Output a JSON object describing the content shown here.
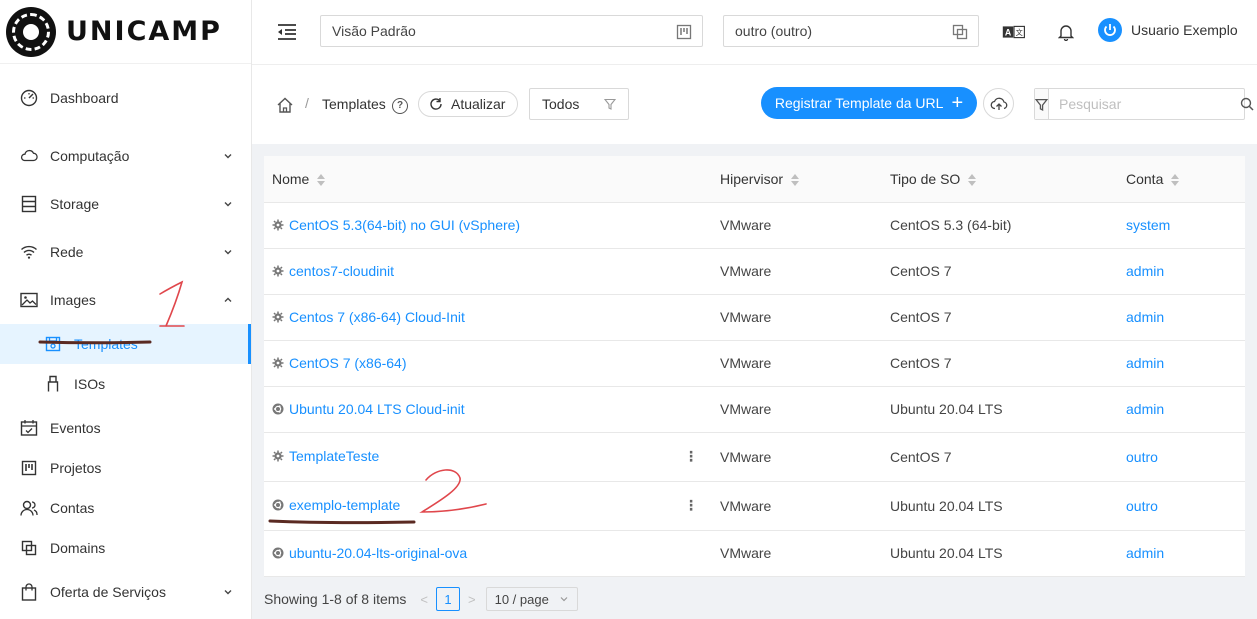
{
  "logo": {
    "text": "UNICAMP"
  },
  "sidebar": {
    "items": [
      {
        "label": "Dashboard",
        "icon": "dashboard-icon"
      },
      {
        "label": "Computação",
        "icon": "cloud-icon",
        "expandable": true
      },
      {
        "label": "Storage",
        "icon": "storage-icon",
        "expandable": true
      },
      {
        "label": "Rede",
        "icon": "wifi-icon",
        "expandable": true
      },
      {
        "label": "Images",
        "icon": "picture-icon",
        "expanded": true
      },
      {
        "label": "Templates",
        "icon": "save-icon",
        "active": true
      },
      {
        "label": "ISOs",
        "icon": "usb-icon"
      },
      {
        "label": "Eventos",
        "icon": "schedule-icon"
      },
      {
        "label": "Projetos",
        "icon": "project-icon"
      },
      {
        "label": "Contas",
        "icon": "team-icon"
      },
      {
        "label": "Domains",
        "icon": "block-icon"
      },
      {
        "label": "Oferta de Serviços",
        "icon": "shopping-icon",
        "expandable": true
      }
    ]
  },
  "header": {
    "view_select": "Visão Padrão",
    "account_select": "outro (outro)",
    "user_name": "Usuario Exemplo"
  },
  "toolbar": {
    "breadcrumb_current": "Templates",
    "help": "?",
    "refresh_label": "Atualizar",
    "filter_value": "Todos",
    "register_label": "Registrar Template da URL",
    "register_plus": "+",
    "search_placeholder": "Pesquisar"
  },
  "table": {
    "columns": [
      "Nome",
      "Hipervisor",
      "Tipo de SO",
      "Conta"
    ],
    "rows": [
      {
        "name": "CentOS 5.3(64-bit) no GUI (vSphere)",
        "os_icon": "gear-icon",
        "hypervisor": "VMware",
        "os_type": "CentOS 5.3 (64-bit)",
        "account": "system"
      },
      {
        "name": "centos7-cloudinit",
        "os_icon": "gear-icon",
        "hypervisor": "VMware",
        "os_type": "CentOS 7",
        "account": "admin"
      },
      {
        "name": "Centos 7 (x86-64) Cloud-Init",
        "os_icon": "gear-icon",
        "hypervisor": "VMware",
        "os_type": "CentOS 7",
        "account": "admin"
      },
      {
        "name": "CentOS 7 (x86-64)",
        "os_icon": "gear-icon",
        "hypervisor": "VMware",
        "os_type": "CentOS 7",
        "account": "admin"
      },
      {
        "name": "Ubuntu 20.04 LTS Cloud-init",
        "os_icon": "ubuntu-icon",
        "hypervisor": "VMware",
        "os_type": "Ubuntu 20.04 LTS",
        "account": "admin"
      },
      {
        "name": "TemplateTeste",
        "os_icon": "gear-icon",
        "hypervisor": "VMware",
        "os_type": "CentOS 7",
        "account": "outro",
        "actions": "⋮"
      },
      {
        "name": "exemplo-template",
        "os_icon": "ubuntu-icon",
        "hypervisor": "VMware",
        "os_type": "Ubuntu 20.04 LTS",
        "account": "outro",
        "actions": "⋮"
      },
      {
        "name": "ubuntu-20.04-lts-original-ova",
        "os_icon": "ubuntu-icon",
        "hypervisor": "VMware",
        "os_type": "Ubuntu 20.04 LTS",
        "account": "admin"
      }
    ]
  },
  "pagination": {
    "summary": "Showing 1-8 of 8 items",
    "current_page": "1",
    "page_size": "10 / page"
  },
  "annotations": {
    "mark_1": "1",
    "mark_2": "2"
  },
  "colors": {
    "primary": "#1890ff",
    "annotation": "#e0474c",
    "underline": "#5a2a22"
  }
}
